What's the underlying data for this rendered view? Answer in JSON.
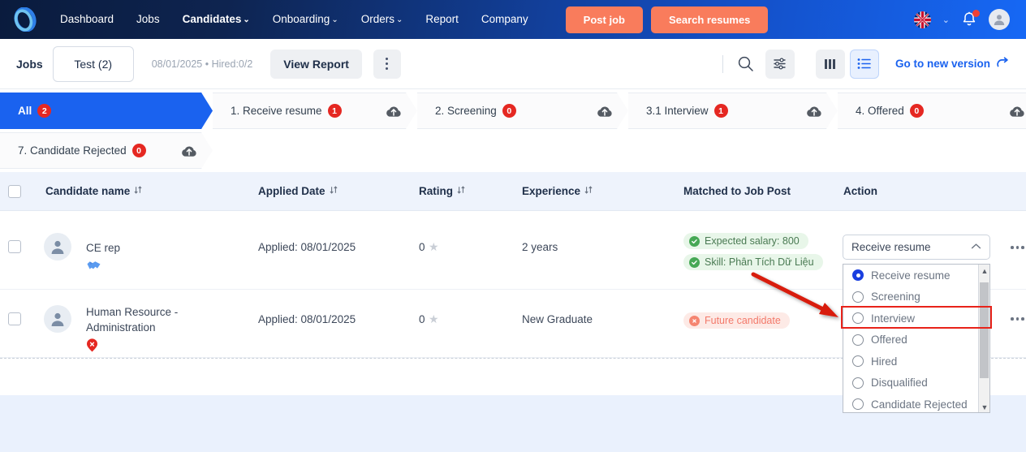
{
  "topnav": {
    "logo_name": "app-logo",
    "links": [
      {
        "label": "Dashboard",
        "caret": "",
        "active": false
      },
      {
        "label": "Jobs",
        "caret": "",
        "active": false
      },
      {
        "label": "Candidates",
        "caret": "⌄",
        "active": true
      },
      {
        "label": "Onboarding",
        "caret": "⌄",
        "active": false
      },
      {
        "label": "Orders",
        "caret": "⌄",
        "active": false
      },
      {
        "label": "Report",
        "caret": "",
        "active": false
      },
      {
        "label": "Company",
        "caret": "",
        "active": false
      }
    ],
    "post_job": "Post job",
    "search_resumes": "Search resumes",
    "flag": "uk-flag-icon",
    "lang_chevron": "⌄",
    "bell": "notification-bell-icon",
    "avatar": "user-avatar-icon",
    "accent_orange": "#f97c5c"
  },
  "toolbar": {
    "jobs_label": "Jobs",
    "job_select": "Test (2)",
    "meta": "08/01/2025 • Hired:0/2",
    "view_report": "View Report",
    "kebab": "more-options-icon",
    "search": "search-icon",
    "filter": "filter-settings-icon",
    "board_view": "board-view-icon",
    "list_view": "list-view-icon",
    "go_new_version": "Go to new version",
    "go_new_version_icon": "external-arrow-icon"
  },
  "pipeline": {
    "row1": [
      {
        "label": "All",
        "count": "2",
        "active": true,
        "cloud": false
      },
      {
        "label": "1. Receive resume",
        "count": "1",
        "active": false,
        "cloud": true
      },
      {
        "label": "2. Screening",
        "count": "0",
        "active": false,
        "cloud": true
      },
      {
        "label": "3.1 Interview",
        "count": "1",
        "active": false,
        "cloud": true
      },
      {
        "label": "4. Offered",
        "count": "0",
        "active": false,
        "cloud": true
      }
    ],
    "row2": [
      {
        "label": "7. Candidate Rejected",
        "count": "0",
        "active": false,
        "cloud": true
      }
    ],
    "cloud_icon": "cloud-upload-icon"
  },
  "table": {
    "select_all": "select-all-checkbox",
    "columns": [
      {
        "label": "Candidate name",
        "sort": true
      },
      {
        "label": "Applied Date",
        "sort": true
      },
      {
        "label": "Rating",
        "sort": true
      },
      {
        "label": "Experience",
        "sort": true
      },
      {
        "label": "Matched to Job Post",
        "sort": false
      },
      {
        "label": "Action",
        "sort": false
      }
    ],
    "rows": [
      {
        "name": "CE rep",
        "badge": "handshake-icon",
        "badge_color": "#5b9bf0",
        "applied": "Applied: 08/01/2025",
        "rating": "0",
        "experience": "2 years",
        "tags": [
          {
            "text": "Expected salary: 800",
            "kind": "green"
          },
          {
            "text": "Skill: Phân Tích Dữ Liệu",
            "kind": "green"
          }
        ],
        "action": "Receive resume"
      },
      {
        "name": "Human Resource - Administration",
        "badge": "rejected-x-icon",
        "badge_color": "#e52822",
        "applied": "Applied: 08/01/2025",
        "rating": "0",
        "experience": "New Graduate",
        "tags": [
          {
            "text": "Future candidate",
            "kind": "red"
          }
        ],
        "action": ""
      }
    ],
    "row_kebab": "row-more-options-icon"
  },
  "dropdown": {
    "selected": "Receive resume",
    "chevron": "⌃",
    "options": [
      {
        "label": "Receive resume",
        "selected": true,
        "highlighted": false
      },
      {
        "label": "Screening",
        "selected": false,
        "highlighted": false
      },
      {
        "label": "Interview",
        "selected": false,
        "highlighted": true
      },
      {
        "label": "Offered",
        "selected": false,
        "highlighted": false
      },
      {
        "label": "Hired",
        "selected": false,
        "highlighted": false
      },
      {
        "label": "Disqualified",
        "selected": false,
        "highlighted": false
      },
      {
        "label": "Candidate Rejected",
        "selected": false,
        "highlighted": false
      }
    ],
    "scroll_up": "▲",
    "scroll_down": "▼",
    "highlight_color": "#e8231a",
    "annotation_arrow": "red-pointer-arrow"
  }
}
